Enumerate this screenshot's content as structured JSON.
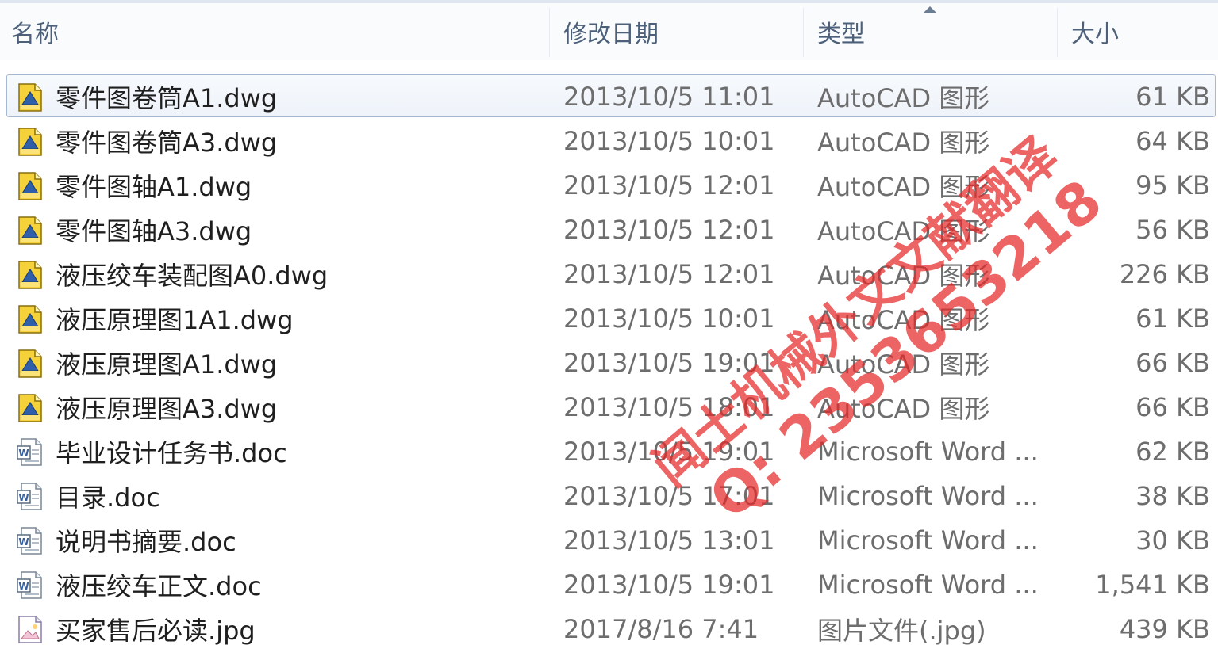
{
  "columns": {
    "name": "名称",
    "date": "修改日期",
    "type": "类型",
    "size": "大小"
  },
  "files": [
    {
      "name": "零件图卷筒A1.dwg",
      "date": "2013/10/5 11:01",
      "type": "AutoCAD 图形",
      "size": "61 KB",
      "icon": "dwg-icon",
      "selected": true
    },
    {
      "name": "零件图卷筒A3.dwg",
      "date": "2013/10/5 10:01",
      "type": "AutoCAD 图形",
      "size": "64 KB",
      "icon": "dwg-icon"
    },
    {
      "name": "零件图轴A1.dwg",
      "date": "2013/10/5 12:01",
      "type": "AutoCAD 图形",
      "size": "95 KB",
      "icon": "dwg-icon"
    },
    {
      "name": "零件图轴A3.dwg",
      "date": "2013/10/5 12:01",
      "type": "AutoCAD 图形",
      "size": "56 KB",
      "icon": "dwg-icon"
    },
    {
      "name": "液压绞车装配图A0.dwg",
      "date": "2013/10/5 12:01",
      "type": "AutoCAD 图形",
      "size": "226 KB",
      "icon": "dwg-icon"
    },
    {
      "name": "液压原理图1A1.dwg",
      "date": "2013/10/5 10:01",
      "type": "AutoCAD 图形",
      "size": "61 KB",
      "icon": "dwg-icon"
    },
    {
      "name": "液压原理图A1.dwg",
      "date": "2013/10/5 19:01",
      "type": "AutoCAD 图形",
      "size": "66 KB",
      "icon": "dwg-icon"
    },
    {
      "name": "液压原理图A3.dwg",
      "date": "2013/10/5 18:01",
      "type": "AutoCAD 图形",
      "size": "66 KB",
      "icon": "dwg-icon"
    },
    {
      "name": "毕业设计任务书.doc",
      "date": "2013/10/5 19:01",
      "type": "Microsoft Word ...",
      "size": "62 KB",
      "icon": "word-doc-icon"
    },
    {
      "name": "目录.doc",
      "date": "2013/10/5 17:01",
      "type": "Microsoft Word ...",
      "size": "38 KB",
      "icon": "word-doc-icon"
    },
    {
      "name": "说明书摘要.doc",
      "date": "2013/10/5 13:01",
      "type": "Microsoft Word ...",
      "size": "30 KB",
      "icon": "word-doc-icon"
    },
    {
      "name": "液压绞车正文.doc",
      "date": "2013/10/5 19:01",
      "type": "Microsoft Word ...",
      "size": "1,541 KB",
      "icon": "word-doc-icon"
    },
    {
      "name": "买家售后必读.jpg",
      "date": "2017/8/16 7:41",
      "type": "图片文件(.jpg)",
      "size": "439 KB",
      "icon": "image-file-icon"
    }
  ],
  "watermark": {
    "line1": "闻士机械外文文献翻译",
    "line2": "Q: 2353653218"
  },
  "colors": {
    "header_text": "#4c607a",
    "selection_border": "#a6b8d1",
    "watermark": "#e62828"
  }
}
